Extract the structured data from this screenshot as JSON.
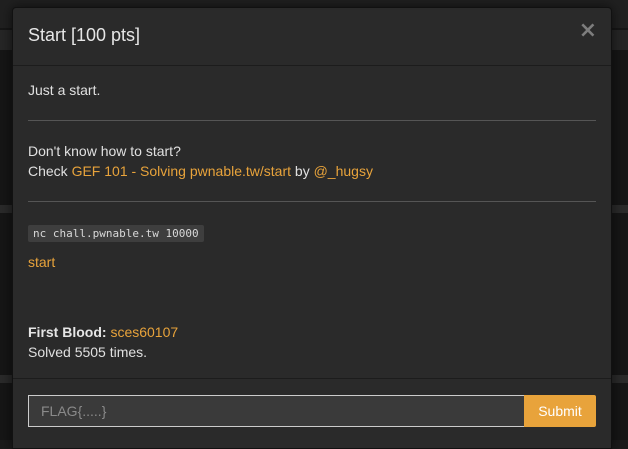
{
  "modal": {
    "title": "Start [100 pts]",
    "close_label": "×",
    "description": "Just a start.",
    "help_line1": "Don't know how to start?",
    "help_prefix": "Check ",
    "help_link": "GEF 101 - Solving pwnable.tw/start",
    "help_by": " by ",
    "help_author": "@_hugsy",
    "command": "nc chall.pwnable.tw 10000",
    "file_link": "start",
    "first_blood_label": "First Blood: ",
    "first_blood_user": "sces60107",
    "solved_text": "Solved 5505 times."
  },
  "footer": {
    "flag_placeholder": "FLAG{.....}",
    "flag_value": "",
    "submit_label": "Submit"
  },
  "colors": {
    "accent": "#e8a33b",
    "modal_bg": "#2a2a2a",
    "text": "#e0e0e0"
  }
}
